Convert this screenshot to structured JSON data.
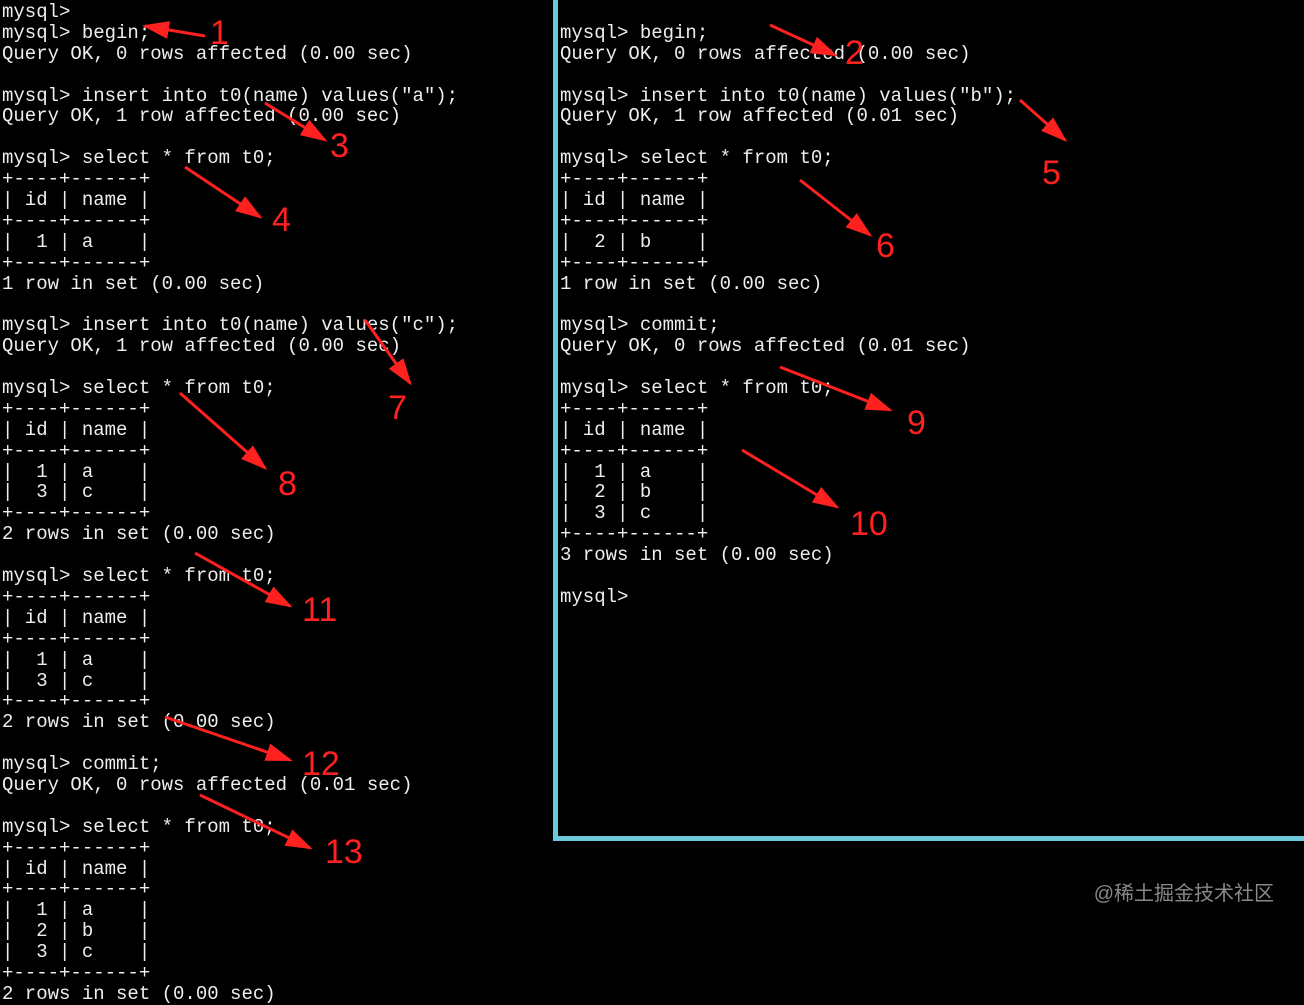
{
  "left_terminal": "mysql>\nmysql> begin;\nQuery OK, 0 rows affected (0.00 sec)\n\nmysql> insert into t0(name) values(\"a\");\nQuery OK, 1 row affected (0.00 sec)\n\nmysql> select * from t0;\n+----+------+\n| id | name |\n+----+------+\n|  1 | a    |\n+----+------+\n1 row in set (0.00 sec)\n\nmysql> insert into t0(name) values(\"c\");\nQuery OK, 1 row affected (0.00 sec)\n\nmysql> select * from t0;\n+----+------+\n| id | name |\n+----+------+\n|  1 | a    |\n|  3 | c    |\n+----+------+\n2 rows in set (0.00 sec)\n\nmysql> select * from t0;\n+----+------+\n| id | name |\n+----+------+\n|  1 | a    |\n|  3 | c    |\n+----+------+\n2 rows in set (0.00 sec)\n\nmysql> commit;\nQuery OK, 0 rows affected (0.01 sec)\n\nmysql> select * from t0;\n+----+------+\n| id | name |\n+----+------+\n|  1 | a    |\n|  2 | b    |\n|  3 | c    |\n+----+------+\n2 rows in set (0.00 sec)",
  "right_terminal": "\nmysql> begin;\nQuery OK, 0 rows affected (0.00 sec)\n\nmysql> insert into t0(name) values(\"b\");\nQuery OK, 1 row affected (0.01 sec)\n\nmysql> select * from t0;\n+----+------+\n| id | name |\n+----+------+\n|  2 | b    |\n+----+------+\n1 row in set (0.00 sec)\n\nmysql> commit;\nQuery OK, 0 rows affected (0.01 sec)\n\nmysql> select * from t0;\n+----+------+\n| id | name |\n+----+------+\n|  1 | a    |\n|  2 | b    |\n|  3 | c    |\n+----+------+\n3 rows in set (0.00 sec)\n\nmysql> ",
  "annotations": {
    "n1": "1",
    "n2": "2",
    "n3": "3",
    "n4": "4",
    "n5": "5",
    "n6": "6",
    "n7": "7",
    "n8": "8",
    "n9": "9",
    "n10": "10",
    "n11": "11",
    "n12": "12",
    "n13": "13"
  },
  "watermark": "@稀土掘金技术社区",
  "colors": {
    "annotation": "#ff2020",
    "divider": "#6cc9d9",
    "text": "#ffffff",
    "bg": "#000000"
  }
}
